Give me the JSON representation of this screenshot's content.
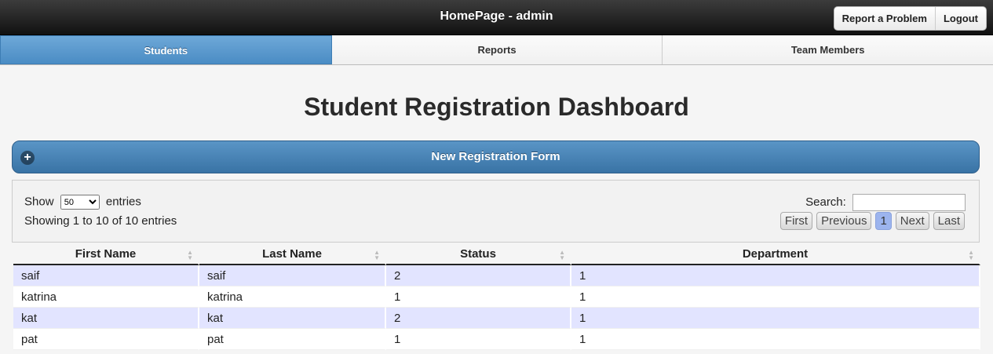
{
  "header": {
    "title": "HomePage - admin",
    "report_label": "Report a Problem",
    "logout_label": "Logout"
  },
  "nav": {
    "tabs": [
      {
        "label": "Students"
      },
      {
        "label": "Reports"
      },
      {
        "label": "Team Members"
      }
    ]
  },
  "page": {
    "title": "Student Registration Dashboard",
    "form_label": "New Registration Form",
    "plus_icon": "+"
  },
  "table_controls": {
    "show_label": "Show",
    "entries_label": "entries",
    "page_size": "50",
    "info": "Showing 1 to 10 of 10 entries",
    "search_label": "Search:",
    "search_value": "",
    "paging": {
      "first": "First",
      "previous": "Previous",
      "current": "1",
      "next": "Next",
      "last": "Last"
    }
  },
  "table": {
    "columns": [
      "First Name",
      "Last Name",
      "Status",
      "Department"
    ],
    "rows": [
      [
        "saif",
        "saif",
        "2",
        "1"
      ],
      [
        "katrina",
        "katrina",
        "1",
        "1"
      ],
      [
        "kat",
        "kat",
        "2",
        "1"
      ],
      [
        "pat",
        "pat",
        "1",
        "1"
      ]
    ]
  },
  "colors": {
    "active_tab": "#4a8cc4",
    "odd_row": "#e2e4ff",
    "current_page": "#9cb4ee"
  }
}
